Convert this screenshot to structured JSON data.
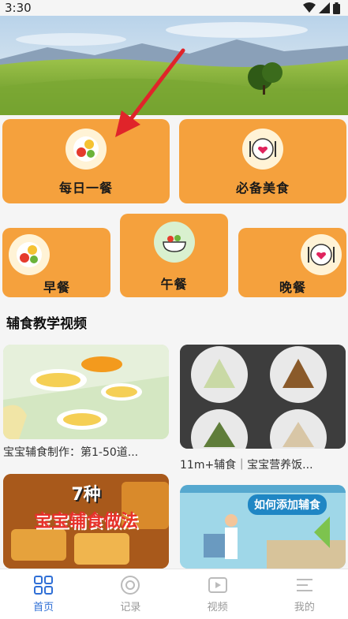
{
  "status": {
    "time": "3:30"
  },
  "cards": {
    "daily_meal": "每日一餐",
    "must_food": "必备美食",
    "breakfast": "早餐",
    "lunch": "午餐",
    "dinner": "晚餐"
  },
  "section": {
    "title": "辅食教学视频"
  },
  "videos": [
    {
      "caption": "宝宝辅食制作：第1-50道..."
    },
    {
      "caption": "11m+辅食｜宝宝营养饭..."
    },
    {
      "overlay_line1": "7种",
      "overlay_line2": "宝宝辅食做法"
    },
    {
      "overlay": "如何添加辅食"
    }
  ],
  "tabs": [
    {
      "label": "首页"
    },
    {
      "label": "记录"
    },
    {
      "label": "视频"
    },
    {
      "label": "我的"
    }
  ],
  "colors": {
    "card": "#f5a13d",
    "active_tab": "#2f6fd6"
  }
}
